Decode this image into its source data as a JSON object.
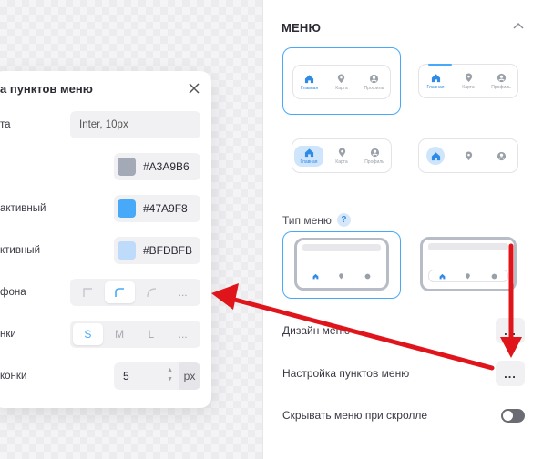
{
  "panel": {
    "title": "МЕНЮ",
    "nav_labels": {
      "home": "Главная",
      "map": "Карта",
      "profile": "Профиль"
    },
    "menu_type_label": "Тип меню",
    "help": "?",
    "rows": {
      "design": "Дизайн меню",
      "items_settings": "Настройка пунктов меню",
      "hide_on_scroll": "Скрывать меню при скролле"
    },
    "dots": "...",
    "hide_on_scroll_enabled": false
  },
  "popup": {
    "title": "а пунктов меню",
    "font_label": "та",
    "font_value": "Inter, 10px",
    "color_label": "",
    "color_value": "#A3A9B6",
    "active_color_label": "активный",
    "active_color_value": "#47A9F8",
    "inactive_color_label": "ктивный",
    "inactive_color_value": "#BFDBFB",
    "bg_label": "фона",
    "bg_more": "...",
    "size_label": "нки",
    "size_options": [
      "S",
      "M",
      "L",
      "..."
    ],
    "size_selected": "S",
    "icon_size_label": "конки",
    "icon_size_value": "5",
    "icon_size_unit": "px"
  },
  "colors": {
    "accent": "#47A9F8",
    "arrow": "#E0151B"
  }
}
